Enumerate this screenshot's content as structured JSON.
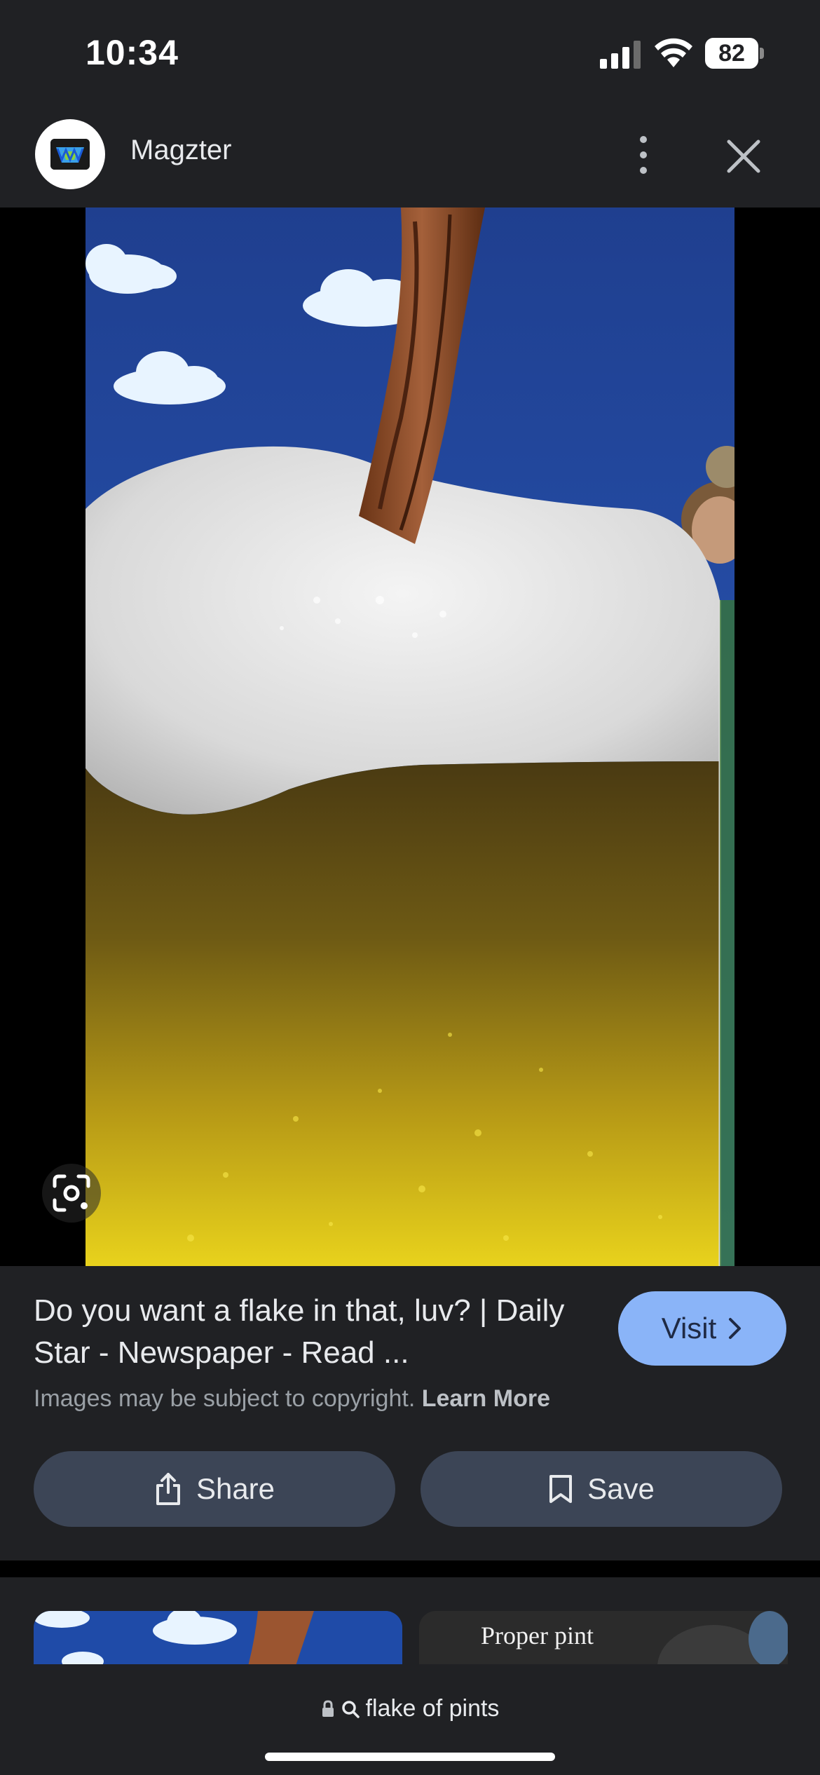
{
  "status_bar": {
    "time": "10:34",
    "battery": "82"
  },
  "header": {
    "source_name": "Magzter",
    "logo_icon": "magzter-logo",
    "more_icon": "more-vert-icon",
    "close_icon": "close-icon"
  },
  "image": {
    "lens_icon": "google-lens-icon"
  },
  "result": {
    "title": "Do you want a flake in that, luv? | Daily Star - Newspaper - Read ...",
    "visit_label": "Visit",
    "copyright_text": "Images may be subject to copyright.",
    "learn_more": "Learn More",
    "share_label": "Share",
    "save_label": "Save"
  },
  "related": {
    "thumb_2_caption": "Proper pint"
  },
  "bottom_bar": {
    "query": "flake of pints"
  },
  "colors": {
    "background": "#202124",
    "visit_button": "#8ab4f8",
    "action_button": "#3c4556"
  }
}
